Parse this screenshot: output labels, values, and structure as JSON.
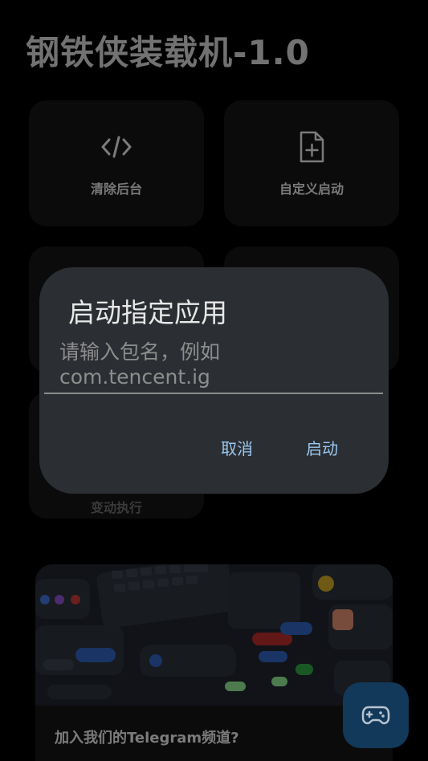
{
  "app": {
    "title": "钢铁侠装载机-1.0"
  },
  "cards": [
    {
      "label": "清除后台",
      "icon": "code-icon"
    },
    {
      "label": "自定义启动",
      "icon": "file-plus-icon"
    },
    {
      "label": "",
      "icon": ""
    },
    {
      "label": "",
      "icon": ""
    },
    {
      "label": "变动执行",
      "icon": ""
    }
  ],
  "banner": {
    "caption": "加入我们的Telegram频道?"
  },
  "fab": {
    "icon": "gamepad-icon",
    "color": "#12385a"
  },
  "dialog": {
    "title": "启动指定应用",
    "input": {
      "value": "",
      "placeholder_line1": "请输入包名，例如",
      "placeholder_line2": "com.tencent.ig"
    },
    "cancel_label": "取消",
    "confirm_label": "启动"
  },
  "colors": {
    "background": "#000000",
    "card": "#141414",
    "dialog": "#2b2f33",
    "accent": "#9cc8f2"
  }
}
